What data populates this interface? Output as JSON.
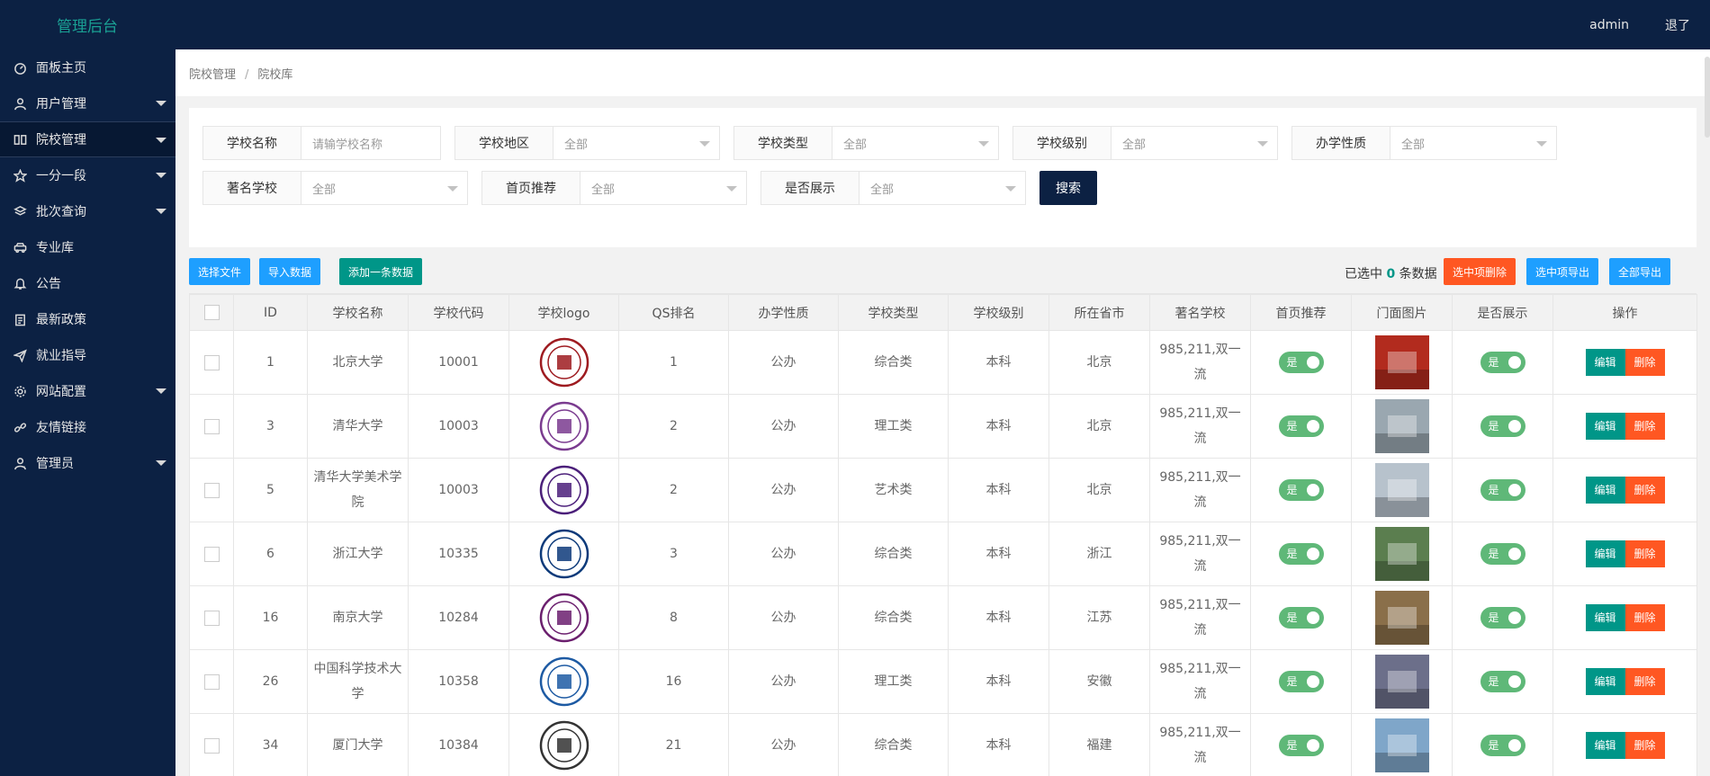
{
  "app": {
    "brand": "管理后台",
    "user": "admin",
    "logout": "退了"
  },
  "sidebar": {
    "items": [
      {
        "label": "面板主页",
        "icon": "dashboard-icon",
        "arrow": false,
        "active": false
      },
      {
        "label": "用户管理",
        "icon": "user-icon",
        "arrow": true,
        "active": false
      },
      {
        "label": "院校管理",
        "icon": "book-icon",
        "arrow": true,
        "active": true
      },
      {
        "label": "一分一段",
        "icon": "star-icon",
        "arrow": true,
        "active": false
      },
      {
        "label": "批次查询",
        "icon": "layers-icon",
        "arrow": true,
        "active": false
      },
      {
        "label": "专业库",
        "icon": "car-icon",
        "arrow": false,
        "active": false
      },
      {
        "label": "公告",
        "icon": "bell-icon",
        "arrow": false,
        "active": false
      },
      {
        "label": "最新政策",
        "icon": "clipboard-icon",
        "arrow": false,
        "active": false
      },
      {
        "label": "就业指导",
        "icon": "send-icon",
        "arrow": false,
        "active": false
      },
      {
        "label": "网站配置",
        "icon": "gear-icon",
        "arrow": true,
        "active": false
      },
      {
        "label": "友情链接",
        "icon": "link-icon",
        "arrow": false,
        "active": false
      },
      {
        "label": "管理员",
        "icon": "admin-icon",
        "arrow": true,
        "active": false
      }
    ]
  },
  "breadcrumb": {
    "parent": "院校管理",
    "sep": "/",
    "current": "院校库"
  },
  "filters": {
    "name": {
      "label": "学校名称",
      "placeholder": "请输学校名称"
    },
    "region": {
      "label": "学校地区",
      "value": "全部"
    },
    "type": {
      "label": "学校类型",
      "value": "全部"
    },
    "level": {
      "label": "学校级别",
      "value": "全部"
    },
    "nature": {
      "label": "办学性质",
      "value": "全部"
    },
    "famous": {
      "label": "著名学校",
      "value": "全部"
    },
    "recommend": {
      "label": "首页推荐",
      "value": "全部"
    },
    "show": {
      "label": "是否展示",
      "value": "全部"
    },
    "search_label": "搜索"
  },
  "toolbar": {
    "choose_file": "选择文件",
    "import": "导入数据",
    "add": "添加一条数据",
    "selected_prefix": "已选中",
    "selected_count": "0",
    "selected_suffix": "条数据",
    "delete_selected": "选中项删除",
    "export_selected": "选中项导出",
    "export_all": "全部导出"
  },
  "table": {
    "columns": [
      "ID",
      "学校名称",
      "学校代码",
      "学校logo",
      "QS排名",
      "办学性质",
      "学校类型",
      "学校级别",
      "所在省市",
      "著名学校",
      "首页推荐",
      "门面图片",
      "是否展示",
      "操作"
    ],
    "rows": [
      {
        "id": "1",
        "name": "北京大学",
        "code": "10001",
        "qs": "1",
        "nature": "公办",
        "type": "综合类",
        "level": "本科",
        "city": "北京",
        "famous": "985,211,双一流",
        "recommend": "是",
        "show": "是",
        "logo_color": "#9e1b20",
        "photo_color": "#b22b1e"
      },
      {
        "id": "3",
        "name": "清华大学",
        "code": "10003",
        "qs": "2",
        "nature": "公办",
        "type": "理工类",
        "level": "本科",
        "city": "北京",
        "famous": "985,211,双一流",
        "recommend": "是",
        "show": "是",
        "logo_color": "#7a3b8f",
        "photo_color": "#9aa7b0"
      },
      {
        "id": "5",
        "name": "清华大学美术学院",
        "code": "10003",
        "qs": "2",
        "nature": "公办",
        "type": "艺术类",
        "level": "本科",
        "city": "北京",
        "famous": "985,211,双一流",
        "recommend": "是",
        "show": "是",
        "logo_color": "#4b1f7a",
        "photo_color": "#b7c2cc"
      },
      {
        "id": "6",
        "name": "浙江大学",
        "code": "10335",
        "qs": "3",
        "nature": "公办",
        "type": "综合类",
        "level": "本科",
        "city": "浙江",
        "famous": "985,211,双一流",
        "recommend": "是",
        "show": "是",
        "logo_color": "#0d3a7a",
        "photo_color": "#5b7e4f"
      },
      {
        "id": "16",
        "name": "南京大学",
        "code": "10284",
        "qs": "8",
        "nature": "公办",
        "type": "综合类",
        "level": "本科",
        "city": "江苏",
        "famous": "985,211,双一流",
        "recommend": "是",
        "show": "是",
        "logo_color": "#6b1f6e",
        "photo_color": "#8a6f4a"
      },
      {
        "id": "26",
        "name": "中国科学技术大学",
        "code": "10358",
        "qs": "16",
        "nature": "公办",
        "type": "理工类",
        "level": "本科",
        "city": "安徽",
        "famous": "985,211,双一流",
        "recommend": "是",
        "show": "是",
        "logo_color": "#1d5aa3",
        "photo_color": "#6c6f8a"
      },
      {
        "id": "34",
        "name": "厦门大学",
        "code": "10384",
        "qs": "21",
        "nature": "公办",
        "type": "综合类",
        "level": "本科",
        "city": "福建",
        "famous": "985,211,双一流",
        "recommend": "是",
        "show": "是",
        "logo_color": "#333333",
        "photo_color": "#7fa6c9"
      }
    ],
    "edit_label": "编辑",
    "delete_label": "删除"
  }
}
